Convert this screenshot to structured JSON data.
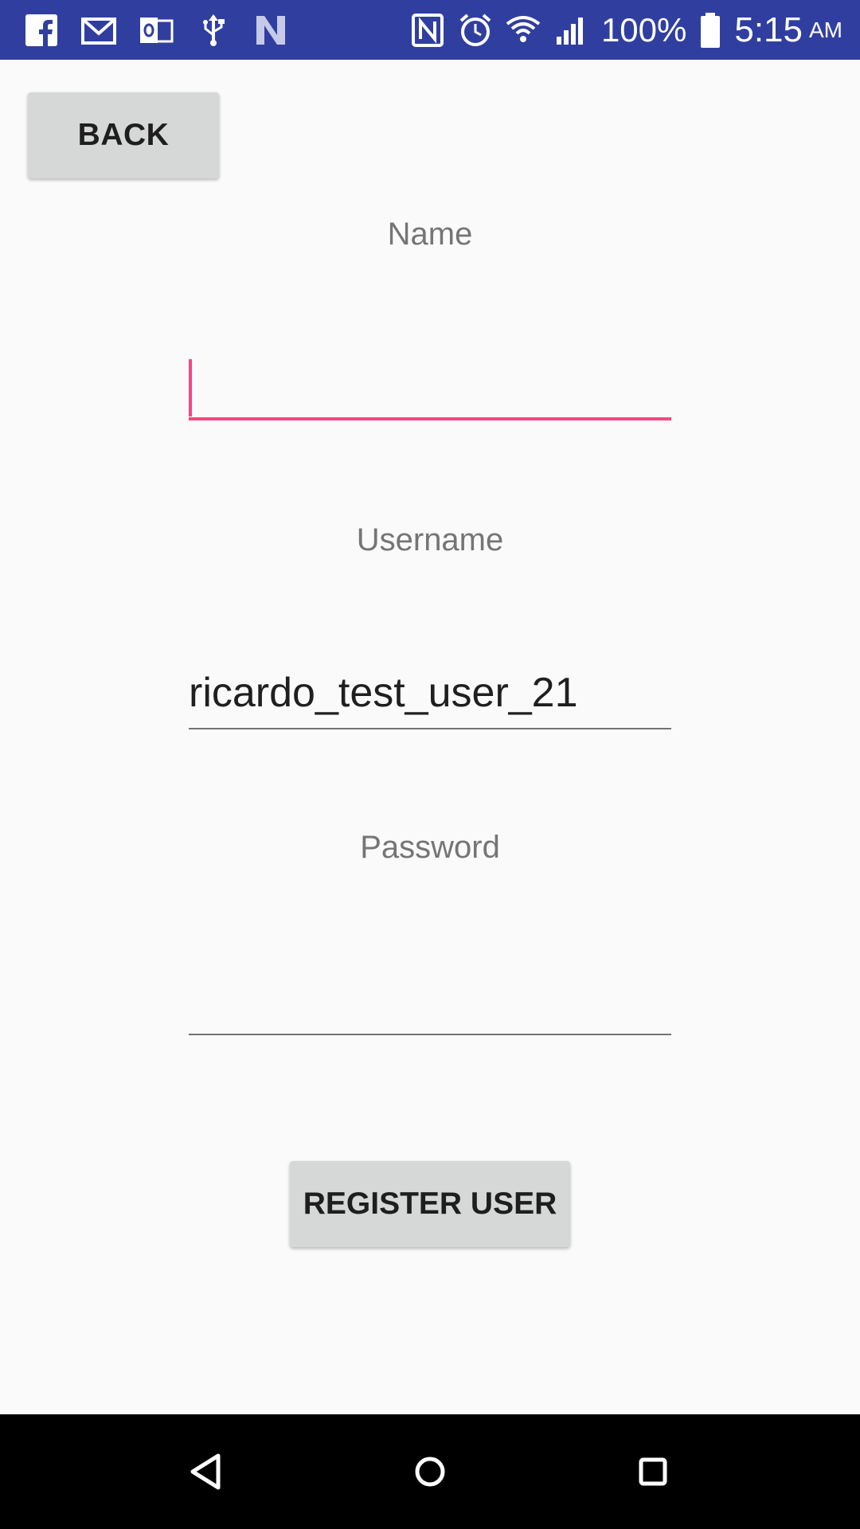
{
  "status_bar": {
    "left_icons": [
      "facebook-icon",
      "gmail-icon",
      "outlook-icon",
      "usb-icon",
      "n-icon"
    ],
    "right_icons": [
      "nfc-icon",
      "alarm-icon",
      "wifi-icon",
      "signal-icon",
      "battery-icon"
    ],
    "battery": "100%",
    "time": "5:15",
    "ampm": "AM",
    "background_color": "#303f9f"
  },
  "toolbar": {
    "back_label": "BACK"
  },
  "form": {
    "name_label": "Name",
    "name_value": "",
    "username_label": "Username",
    "username_value": "ricardo_test_user_21",
    "password_label": "Password",
    "password_value": "",
    "accent_color": "#f4477f"
  },
  "actions": {
    "register_label": "REGISTER USER"
  },
  "nav_bar": {
    "buttons": [
      "back-triangle-icon",
      "home-circle-icon",
      "recents-square-icon"
    ]
  }
}
